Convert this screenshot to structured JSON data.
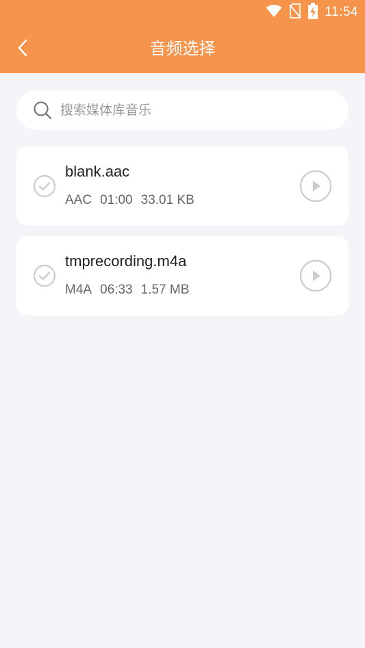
{
  "status_bar": {
    "time": "11:54",
    "icons": [
      "wifi-icon",
      "no-sim-icon",
      "battery-charging-icon"
    ]
  },
  "header": {
    "title": "音频选择",
    "back_icon": "chevron-left-icon",
    "background_color": "#f5944a"
  },
  "search": {
    "placeholder": "搜索媒体库音乐",
    "value": "",
    "icon": "search-icon"
  },
  "files": [
    {
      "name": "blank.aac",
      "format": "AAC",
      "duration": "01:00",
      "size": "33.01 KB",
      "selected": false
    },
    {
      "name": "tmprecording.m4a",
      "format": "M4A",
      "duration": "06:33",
      "size": "1.57 MB",
      "selected": false
    }
  ],
  "colors": {
    "accent": "#f5944a",
    "background": "#f4f4f9",
    "card": "#ffffff",
    "icon_gray": "#cccccc"
  }
}
